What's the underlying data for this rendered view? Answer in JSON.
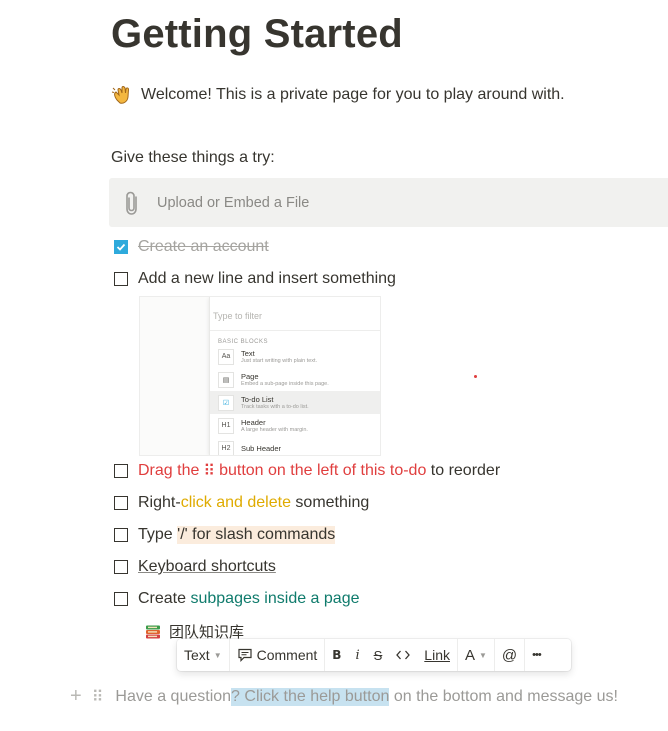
{
  "page": {
    "title": "Getting Started",
    "welcome": "Welcome! This is a private page for you to play around with.",
    "intro": "Give these things a try:"
  },
  "upload": {
    "label": "Upload or Embed a File",
    "icon": "paperclip-icon"
  },
  "todos": [
    {
      "text": "Create an account",
      "checked": true
    },
    {
      "text": "Add a new line and insert something",
      "checked": false
    },
    {
      "parts": [
        "Drag the ",
        "⠿",
        " button on the left of this to-do",
        " to reorder"
      ],
      "checked": false
    },
    {
      "parts": [
        "Right-",
        "click and delete",
        " something"
      ],
      "checked": false
    },
    {
      "parts": [
        "Type ",
        "'/' for slash commands"
      ],
      "checked": false
    },
    {
      "text": "Keyboard shortcuts",
      "checked": false
    },
    {
      "parts": [
        "Create ",
        "subpages inside a page"
      ],
      "checked": false
    }
  ],
  "preview": {
    "filter_placeholder": "Type to filter",
    "section": "BASIC BLOCKS",
    "items": [
      {
        "name": "Text",
        "desc": "Just start writing with plain text.",
        "thumb": "Aa"
      },
      {
        "name": "Page",
        "desc": "Embed a sub-page inside this page.",
        "thumb": "▤"
      },
      {
        "name": "To-do List",
        "desc": "Track tasks with a to-do list.",
        "thumb": "☑"
      },
      {
        "name": "Header",
        "desc": "A large header with margin.",
        "thumb": "H1"
      },
      {
        "name": "Sub Header",
        "desc": "",
        "thumb": "H2"
      }
    ]
  },
  "subpage": {
    "title": "团队知识库"
  },
  "toolbar": {
    "text": "Text",
    "comment": "Comment",
    "bold": "B",
    "italic": "i",
    "strike": "S",
    "code": "<>",
    "link": "Link",
    "color": "A",
    "mention": "@",
    "more": "•••"
  },
  "question": {
    "before": "Have a question",
    "highlight": "? Click the help button",
    "after": " on the bottom and message us!"
  },
  "colors": {
    "checkbox_checked": "#2eaadc",
    "red": "#e03e3e",
    "yellow": "#dfab01",
    "orange_bg": "#fbecdd",
    "teal": "#0f7b6c",
    "highlight_bg": "#c7e2f0"
  }
}
